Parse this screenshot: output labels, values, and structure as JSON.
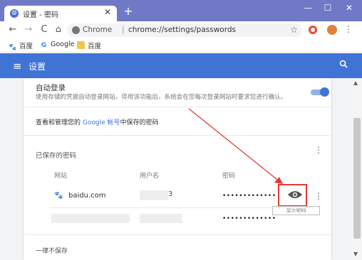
{
  "browser": {
    "tab_title": "设置 - 密码",
    "tab_close": "✕",
    "new_tab": "+",
    "window_controls": {
      "minimize": "—",
      "maximize": "☐",
      "close": "✕"
    },
    "nav": {
      "back": "←",
      "forward": "→",
      "reload": "C",
      "home": "⌂"
    },
    "omnibox": {
      "scheme_label": "Chrome",
      "separator": "|",
      "url": "chrome://settings/passwords",
      "star": "☆"
    },
    "menu_icon": "⋮"
  },
  "bookmarks": [
    {
      "label": "百度",
      "icon": "baidu-paw-icon"
    },
    {
      "label": "Google",
      "icon": "google-g-icon"
    },
    {
      "label": "百度",
      "icon": "folder-icon"
    }
  ],
  "settings_header": {
    "menu_glyph": "≡",
    "title": "设置",
    "search_glyph": "🔍"
  },
  "auto_signin": {
    "title": "自动登录",
    "description": "使用存储的凭据自动登录网站。停用该功能后，系统会在您每次登录网站时要求您进行确认。",
    "enabled": true
  },
  "manage": {
    "prefix": "查看和管理您的 ",
    "link": "Google 帐号",
    "suffix": "中保存的密码"
  },
  "saved_passwords": {
    "title": "已保存的密码",
    "more_icon": "⋮",
    "columns": {
      "site": "网站",
      "username": "用户名",
      "password": "密码"
    },
    "rows": [
      {
        "site": "baidu.com",
        "username_visible": "3",
        "password": "•••••••••••••",
        "show_tooltip": "显示密码"
      },
      {
        "site": "",
        "username_visible": "",
        "password": "•••••••••••••"
      }
    ]
  },
  "never_saved": {
    "title": "一律不保存"
  },
  "colors": {
    "titlebar": "#6f79c6",
    "settings_header": "#3f74d6",
    "annotation_red": "#e53935"
  }
}
